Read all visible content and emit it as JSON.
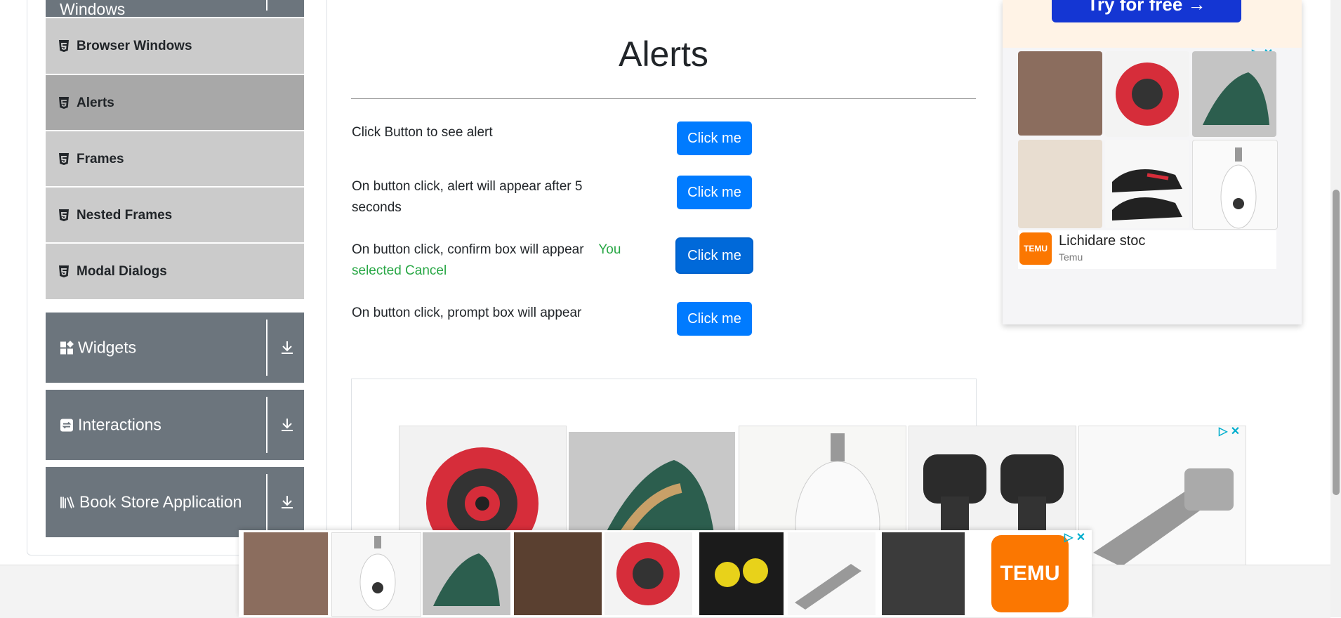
{
  "sidebar": {
    "partial_header": "Windows",
    "items": [
      {
        "label": "Browser Windows"
      },
      {
        "label": "Alerts"
      },
      {
        "label": "Frames"
      },
      {
        "label": "Nested Frames"
      },
      {
        "label": "Modal Dialogs"
      }
    ],
    "groups": [
      {
        "label": "Widgets"
      },
      {
        "label": "Interactions"
      },
      {
        "label": "Book Store Application"
      }
    ]
  },
  "main": {
    "title": "Alerts",
    "rows": [
      {
        "text": "Click Button to see alert",
        "button": "Click me"
      },
      {
        "text": "On button click, alert will appear after 5 seconds",
        "button": "Click me"
      },
      {
        "text": "On button click, confirm box will appear",
        "result": "You selected Cancel",
        "button": "Click me"
      },
      {
        "text": "On button click, prompt box will appear",
        "button": "Click me"
      }
    ]
  },
  "ads": {
    "top_banner": "Try for free",
    "top_brand_title": "Lichidare stoc",
    "top_brand_sub": "Temu",
    "temu_logo": "TEMU",
    "temu_small_logo": "TEMU"
  },
  "colors": {
    "primary": "#007bff",
    "success": "#28a745",
    "sidebar_group": "#6c757d",
    "temu": "#fb7701"
  }
}
